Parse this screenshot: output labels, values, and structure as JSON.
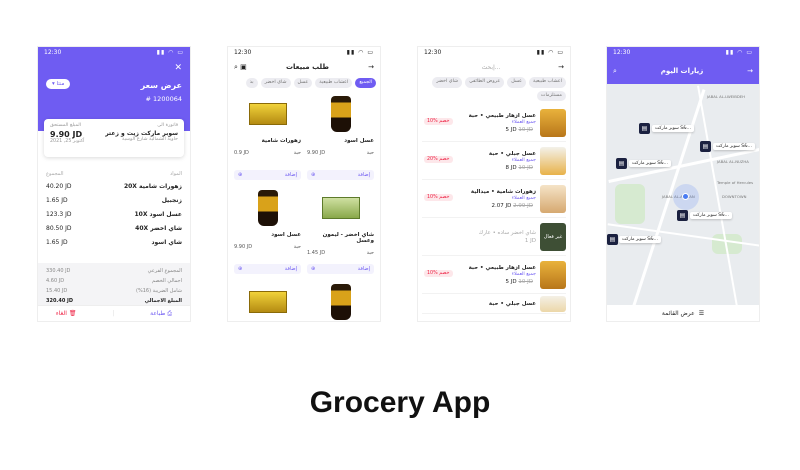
{
  "caption": "Grocery App",
  "time": "12:30",
  "quote": {
    "title": "عرض سعر",
    "number": "# 1200064",
    "status_chip": "منتا",
    "bill_to_label": "فاتورة الى",
    "customer": "سوبر ماركت زيت و زعتر",
    "address": "حاوية الشمالية شارع الوسية",
    "amount_label": "المبلغ المستحق",
    "amount": "9.90 JD",
    "date": "أكتوبر 25, 2021",
    "col_item": "المواد",
    "col_total": "المجموع",
    "items": [
      {
        "name": "زهورات شامية",
        "qty": "20X",
        "total": "40.20 JD"
      },
      {
        "name": "زنجبيل",
        "qty": "",
        "total": "1.65 JD"
      },
      {
        "name": "عسل اسود",
        "qty": "10X",
        "total": "123.3 JD"
      },
      {
        "name": "شاي اخضر",
        "qty": "40X",
        "total": "80.50 JD"
      },
      {
        "name": "شاي اسود",
        "qty": "",
        "total": "1.65 JD"
      }
    ],
    "summary": [
      {
        "label": "المجموع الفرعي",
        "value": "330.40 JD"
      },
      {
        "label": "اجمالي الخصم",
        "value": "4.60 JD"
      },
      {
        "label": "شامل الضريبة (16%)",
        "value": "15.40 JD"
      },
      {
        "label": "المبلغ الاجمالي",
        "value": "320.40 JD"
      }
    ],
    "print_label": "طباعة",
    "cancel_label": "الغاء"
  },
  "sales": {
    "title": "طلب مبيعات",
    "chips": [
      "الجميع",
      "اعشاب طبيعية",
      "عسل",
      "شاي اخضر",
      "بذ"
    ],
    "products": [
      {
        "name": "زهورات شامية",
        "unit": "حبة",
        "price": "0.9 JD",
        "add": "إضافة",
        "img": "box"
      },
      {
        "name": "عسل اسود",
        "unit": "حبة",
        "price": "9.90 JD",
        "add": "إضافة",
        "img": "jar"
      },
      {
        "name": "عسل اسود",
        "unit": "حبة",
        "price": "9.90 JD",
        "add": "إضافة",
        "img": "jar"
      },
      {
        "name": "شاي اخضر - ليمون وعسل",
        "unit": "حبة",
        "price": "1.45 JD",
        "add": "إضافة",
        "img": "box-green"
      },
      {
        "name": "",
        "unit": "",
        "price": "",
        "add": "",
        "img": "box"
      },
      {
        "name": "",
        "unit": "",
        "price": "",
        "add": "",
        "img": "jar"
      }
    ]
  },
  "catalog": {
    "search_placeholder": "إبحث...",
    "chips": [
      "اعشاب طبيعية",
      "عسل",
      "عروض الطائفي",
      "شاي اخضر",
      "مستلزمات"
    ],
    "items": [
      {
        "name": "عسل ازهار طبيعي • حبة",
        "sub": "جميع العملاء",
        "old": "10 JD",
        "price": "5 JD",
        "badge": "خصم %10",
        "thumb": "t1",
        "dim": false
      },
      {
        "name": "عسل جبلي • حبة",
        "sub": "جميع العملاء",
        "old": "10 JD",
        "price": "8 JD",
        "badge": "خصم %20",
        "thumb": "t2",
        "dim": false
      },
      {
        "name": "زهورات شامية • ميدالية",
        "sub": "جميع العملاء",
        "old": "2.99 JD",
        "price": "2.07 JD",
        "badge": "خصم %10",
        "thumb": "t3",
        "dim": false
      },
      {
        "name": "شاي اخضر ساده • عارك",
        "sub": "",
        "old": "",
        "price": "1 JD",
        "badge": "",
        "thumb": "t4",
        "thumb_text": "غير فعال",
        "dim": true
      },
      {
        "name": "عسل ازهار طبيعي • حبة",
        "sub": "جميع العملاء",
        "old": "10 JD",
        "price": "5 JD",
        "badge": "خصم %10",
        "thumb": "t1",
        "dim": false
      },
      {
        "name": "عسل جبلي • حبة",
        "sub": "",
        "old": "",
        "price": "",
        "badge": "",
        "thumb": "t5",
        "dim": false
      }
    ]
  },
  "visits": {
    "title": "زيارات اليوم",
    "pins": [
      {
        "label": "سوبر ماركت S&..."
      },
      {
        "label": "سوبر ماركت S&..."
      },
      {
        "label": "سوبر ماركت S&..."
      },
      {
        "label": "سوبر ماركت S&..."
      },
      {
        "label": "سوبر ماركت S&..."
      }
    ],
    "map_labels": [
      "JABAL AL-LWEIBDEH",
      "JABAL AL-AMMAN",
      "JABAL AL-NUZHA",
      "DOWNTOWN",
      "Temple of Hercules"
    ],
    "list_view": "عرض القائمة"
  },
  "colors": {
    "accent": "#6f5cf2",
    "danger": "#e24455"
  }
}
